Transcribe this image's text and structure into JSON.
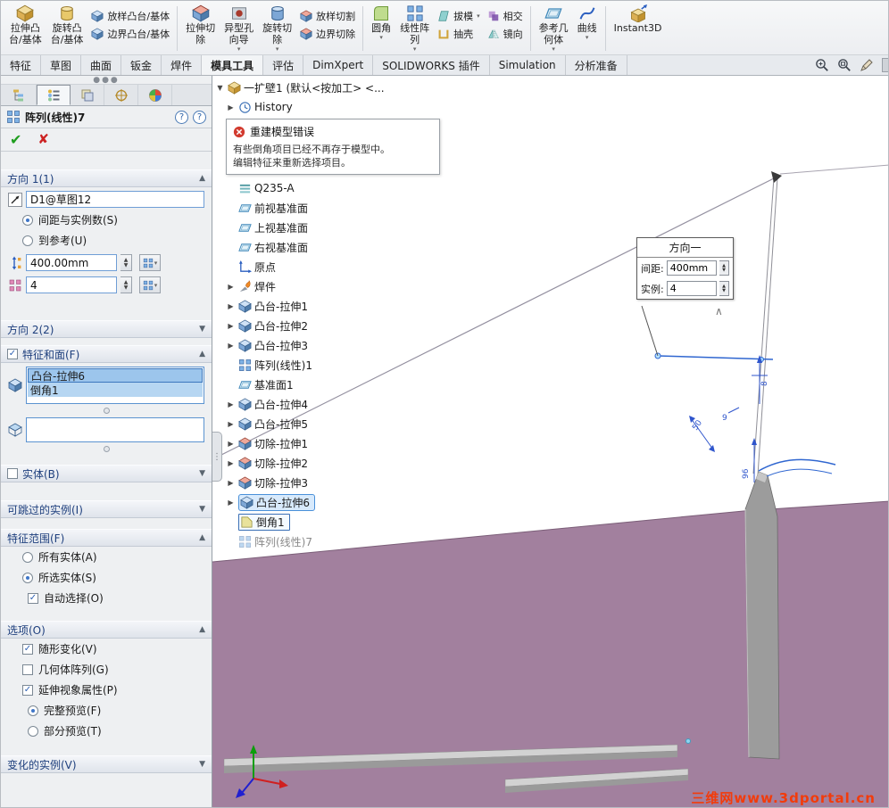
{
  "colors": {
    "accent_blue": "#2b6cb5",
    "selection_fill": "#9cc5ec",
    "error_red": "#d23b2f",
    "confirm_green": "#1f9e1f",
    "cancel_red": "#cc2222",
    "model_plate": "#a2809e",
    "model_rib": "#9c9c9c",
    "dimension_blue": "#2f55cc",
    "watermark_red": "#f23b0b"
  },
  "ribbon": {
    "large": [
      {
        "l1": "拉伸凸",
        "l2": "台/基体"
      },
      {
        "l1": "旋转凸",
        "l2": "台/基体"
      },
      {
        "l1": "拉伸切",
        "l2": "除"
      },
      {
        "l1": "异型孔",
        "l2": "向导"
      },
      {
        "l1": "旋转切",
        "l2": "除"
      },
      {
        "l1": "圆角",
        "l2": ""
      },
      {
        "l1": "线性阵",
        "l2": "列"
      },
      {
        "l1": "参考几",
        "l2": "何体"
      },
      {
        "l1": "曲线",
        "l2": ""
      },
      {
        "l1": "Instant3D",
        "l2": ""
      }
    ],
    "small": [
      "放样凸台/基体",
      "边界凸台/基体",
      "放样切割",
      "边界切除",
      "拔模",
      "抽壳",
      "相交",
      "镜向"
    ]
  },
  "tabs": [
    "特征",
    "草图",
    "曲面",
    "钣金",
    "焊件",
    "模具工具",
    "评估",
    "DimXpert",
    "SOLIDWORKS 插件",
    "Simulation",
    "分析准备"
  ],
  "pm": {
    "title": "阵列(线性)7",
    "dir1": {
      "header": "方向 1(1)",
      "ref": "D1@草图12",
      "radio_spacing": {
        "label": "间距与实例数(S)",
        "checked": true
      },
      "radio_ref": {
        "label": "到参考(U)",
        "checked": false
      },
      "spacing": "400.00mm",
      "count": "4"
    },
    "dir2": {
      "header": "方向 2(2)"
    },
    "features": {
      "header": "特征和面(F)",
      "checked": true,
      "items": [
        "凸台-拉伸6",
        "倒角1"
      ]
    },
    "bodies": {
      "header": "实体(B)",
      "checked": false
    },
    "skipped": {
      "header": "可跳过的实例(I)"
    },
    "scope": {
      "header": "特征范围(F)",
      "radio_all": {
        "label": "所有实体(A)",
        "checked": false
      },
      "radio_sel": {
        "label": "所选实体(S)",
        "checked": true
      },
      "chk_auto": {
        "label": "自动选择(O)",
        "checked": true
      }
    },
    "options": {
      "header": "选项(O)",
      "chk_vary": {
        "label": "随形变化(V)",
        "checked": true
      },
      "chk_geo": {
        "label": "几何体阵列(G)",
        "checked": false
      },
      "chk_vis": {
        "label": "延伸视象属性(P)",
        "checked": true
      },
      "radio_full": {
        "label": "完整预览(F)",
        "checked": true
      },
      "radio_part": {
        "label": "部分预览(T)",
        "checked": false
      }
    },
    "varied": {
      "header": "变化的实例(V)"
    }
  },
  "tree": {
    "root": "一扩壁1 (默认<按加工> <...",
    "history": "History",
    "error": {
      "title": "重建模型错误",
      "line1": "有些倒角项目已经不再存于模型中。",
      "line2": "编辑特征来重新选择项目。"
    },
    "material": "Q235-A",
    "items": [
      "前视基准面",
      "上视基准面",
      "右视基准面",
      "原点",
      "焊件",
      "凸台-拉伸1",
      "凸台-拉伸2",
      "凸台-拉伸3",
      "阵列(线性)1",
      "基准面1",
      "凸台-拉伸4",
      "凸台-拉伸5",
      "切除-拉伸1",
      "切除-拉伸2",
      "切除-拉伸3",
      "凸台-拉伸6",
      "倒角1",
      "阵列(线性)7"
    ]
  },
  "callout": {
    "title": "方向一",
    "spacing_label": "间距:",
    "spacing_value": "400mm",
    "count_label": "实例:",
    "count_value": "4"
  },
  "scene": {
    "dims": {
      "thickness": "8",
      "offset": "9",
      "length": "50",
      "height": "96"
    },
    "watermark": "三维网www.3dportal.cn"
  }
}
